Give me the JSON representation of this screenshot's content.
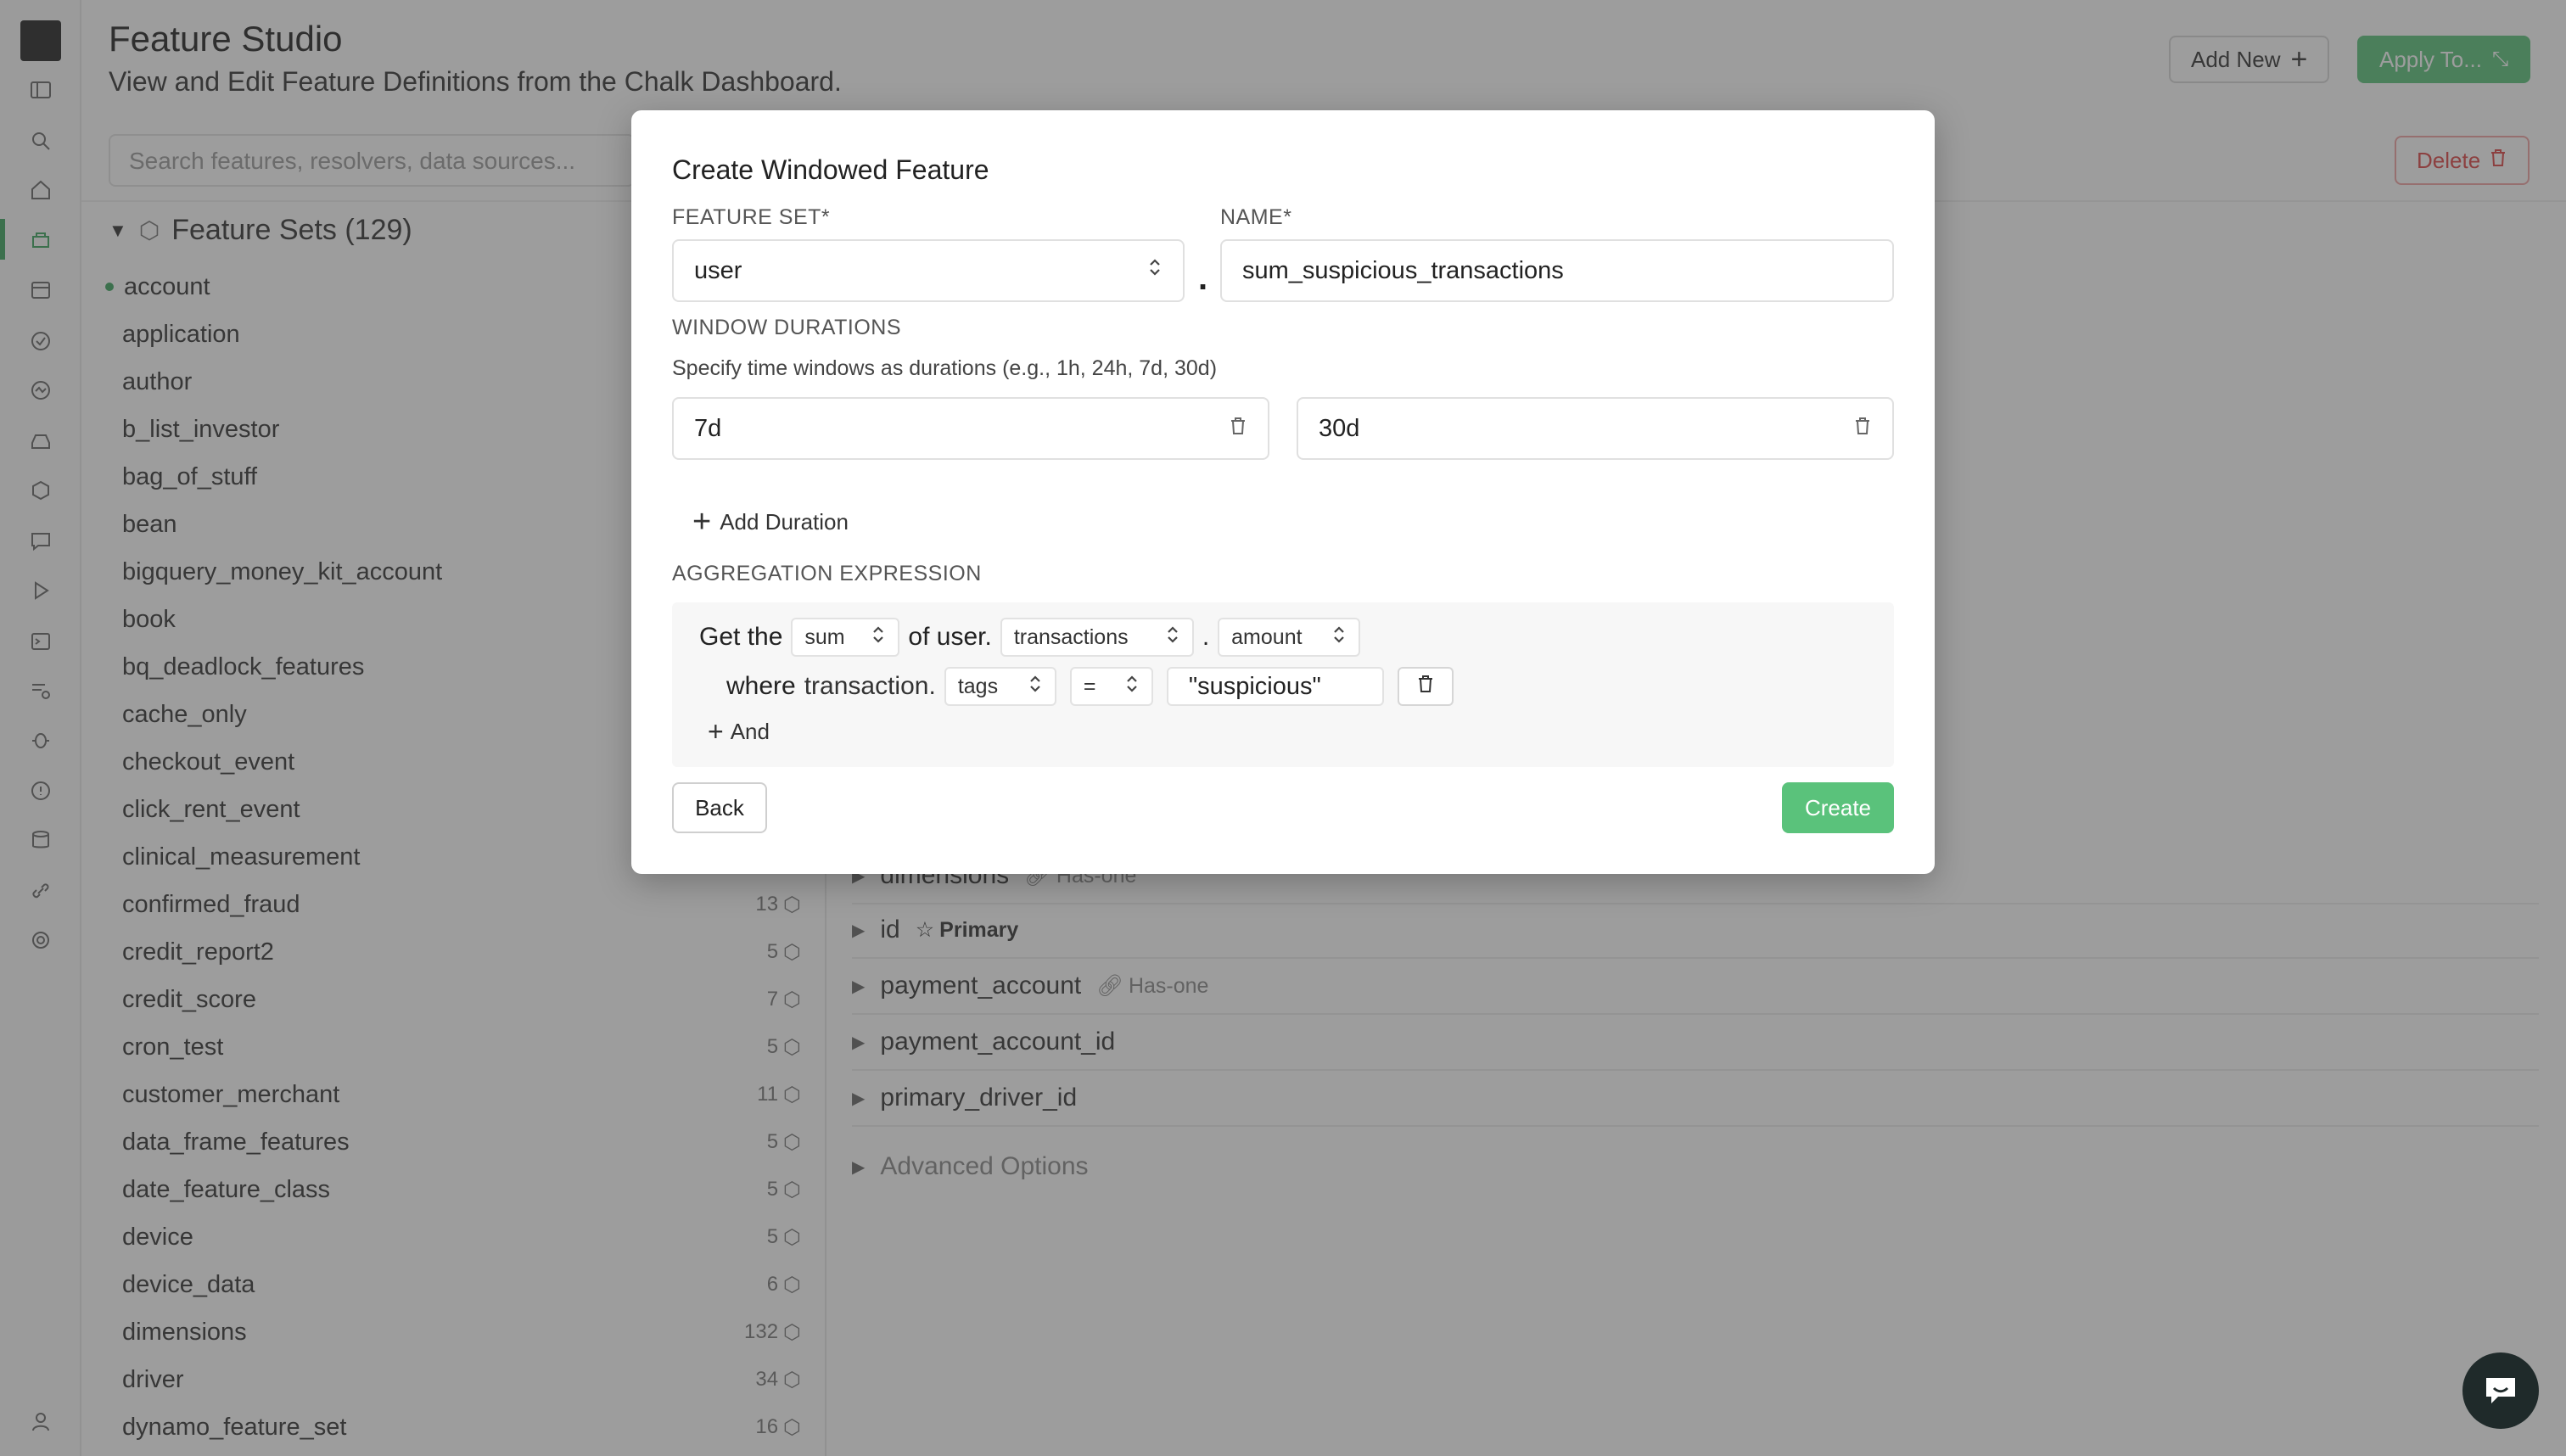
{
  "header": {
    "title": "Feature Studio",
    "subtitle": "View and Edit Feature Definitions from the Chalk Dashboard.",
    "add_new_label": "Add New",
    "apply_label": "Apply To..."
  },
  "search": {
    "placeholder": "Search features, resolvers, data sources..."
  },
  "delete_label": "Delete",
  "feature_sets": {
    "label": "Feature Sets (129)",
    "items": [
      {
        "name": "account",
        "count": ""
      },
      {
        "name": "application",
        "count": ""
      },
      {
        "name": "author",
        "count": ""
      },
      {
        "name": "b_list_investor",
        "count": ""
      },
      {
        "name": "bag_of_stuff",
        "count": ""
      },
      {
        "name": "bean",
        "count": ""
      },
      {
        "name": "bigquery_money_kit_account",
        "count": ""
      },
      {
        "name": "book",
        "count": ""
      },
      {
        "name": "bq_deadlock_features",
        "count": ""
      },
      {
        "name": "cache_only",
        "count": ""
      },
      {
        "name": "checkout_event",
        "count": ""
      },
      {
        "name": "click_rent_event",
        "count": ""
      },
      {
        "name": "clinical_measurement",
        "count": ""
      },
      {
        "name": "confirmed_fraud",
        "count": "13"
      },
      {
        "name": "credit_report2",
        "count": "5"
      },
      {
        "name": "credit_score",
        "count": "7"
      },
      {
        "name": "cron_test",
        "count": "5"
      },
      {
        "name": "customer_merchant",
        "count": "11"
      },
      {
        "name": "data_frame_features",
        "count": "5"
      },
      {
        "name": "date_feature_class",
        "count": "5"
      },
      {
        "name": "device",
        "count": "5"
      },
      {
        "name": "device_data",
        "count": "6"
      },
      {
        "name": "dimensions",
        "count": "132"
      },
      {
        "name": "driver",
        "count": "34"
      },
      {
        "name": "dynamo_feature_set",
        "count": "16"
      }
    ]
  },
  "features": {
    "rows": [
      {
        "name": "dimensions",
        "tag": "Has-one"
      },
      {
        "name": "id",
        "tag": "Primary"
      },
      {
        "name": "payment_account",
        "tag": "Has-one"
      },
      {
        "name": "payment_account_id",
        "tag": ""
      },
      {
        "name": "primary_driver_id",
        "tag": ""
      }
    ],
    "advanced": "Advanced Options"
  },
  "modal": {
    "title": "Create Windowed Feature",
    "feature_set_label": "FEATURE SET*",
    "feature_set_value": "user",
    "name_label": "NAME*",
    "name_value": "sum_suspicious_transactions",
    "window_label": "WINDOW DURATIONS",
    "window_help": "Specify time windows as durations (e.g., 1h, 24h, 7d, 30d)",
    "durations": [
      "7d",
      "30d"
    ],
    "add_duration": "Add Duration",
    "agg_label": "AGGREGATION EXPRESSION",
    "agg": {
      "get_the": "Get the",
      "func": "sum",
      "of_user": "of user.",
      "relation": "transactions",
      "dot": ".",
      "field": "amount",
      "where": "where",
      "transaction": "transaction.",
      "filter_field": "tags",
      "operator": "=",
      "filter_value": "\"suspicious\"",
      "and": "And"
    },
    "back": "Back",
    "create": "Create"
  },
  "colors": {
    "accent": "#5ac27b",
    "danger": "#dd4444",
    "overlay": "rgba(60,60,60,0.5)"
  }
}
